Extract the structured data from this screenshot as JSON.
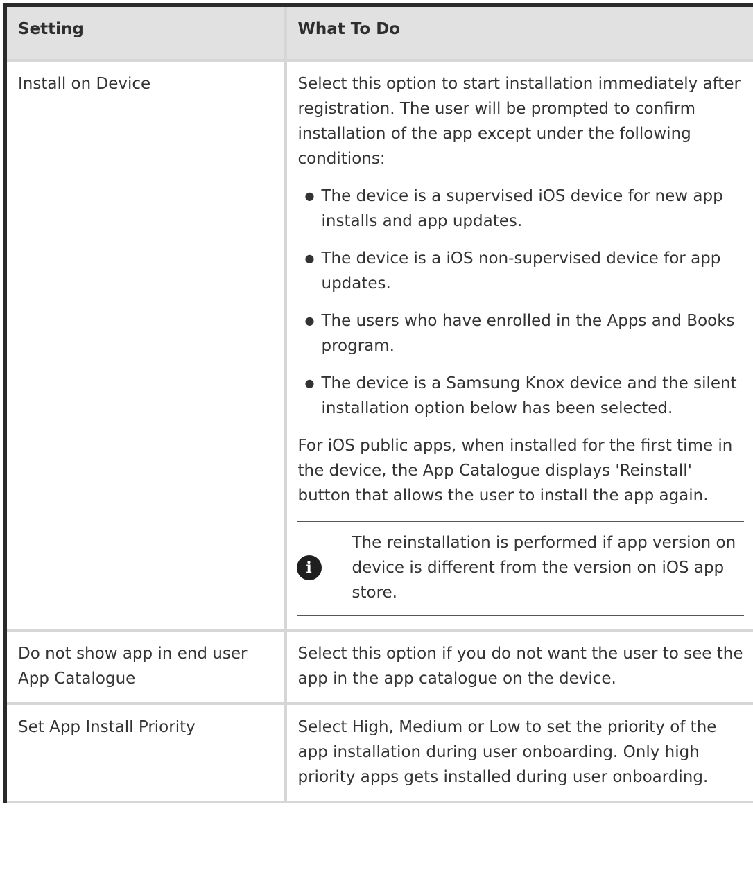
{
  "table": {
    "headers": [
      "Setting",
      "What To Do"
    ],
    "rows": [
      {
        "setting": "Install on Device",
        "intro": "Select this option to start installation immediately after registration. The user will be prompted to confirm installation of the app except under the following conditions:",
        "bullets": [
          "The device is a supervised iOS device for new app installs and app updates.",
          "The device is a iOS non-supervised device for app updates.",
          "The users who have enrolled in the Apps and Books program.",
          "The device is a Samsung Knox device and the silent installation option below has been selected."
        ],
        "after": "For iOS public apps, when installed for the first time in the device, the App Catalogue displays 'Reinstall' button that allows the user to install the app again.",
        "note": "The reinstallation is performed if app version on device is different from the version on iOS app store."
      },
      {
        "setting": "Do not show app in end user App Catalogue",
        "description": "Select this option if you do not want the user to see the app in the app catalogue on the device."
      },
      {
        "setting": "Set App Install Priority",
        "description": "Select High, Medium or Low to set the priority of the app installation during user onboarding. Only high priority apps gets installed during user onboarding."
      }
    ]
  },
  "icons": {
    "note_icon": "info-icon",
    "bullet_icon": "bullet-dot"
  },
  "colors": {
    "header_background": "#e1e1e1",
    "note_rule": "#c1272d",
    "border": "#d6d6d6"
  }
}
